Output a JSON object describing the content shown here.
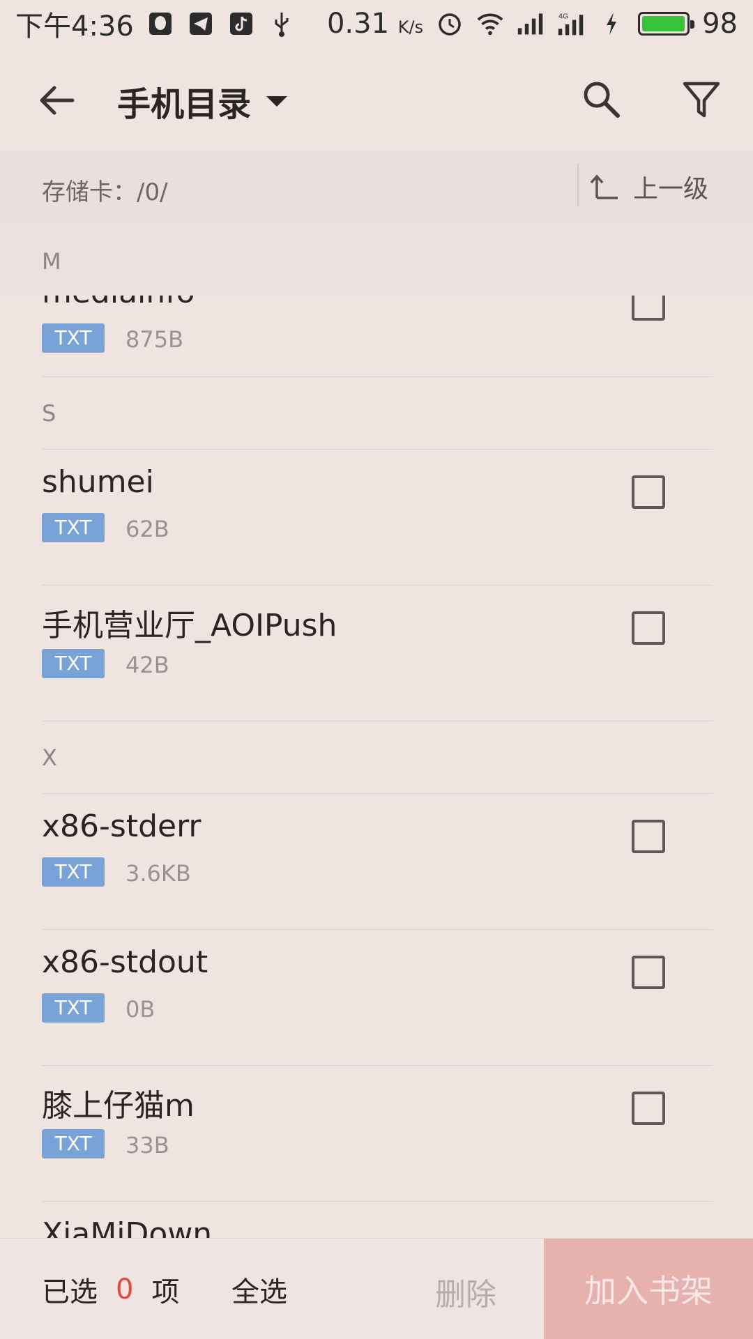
{
  "status_bar": {
    "time": "下午4:36",
    "speed": "0.31",
    "speed_unit": "K/s",
    "battery": "98",
    "battery_level": 0.98,
    "icons": [
      "qq-icon",
      "telegram-icon",
      "tiktok-icon",
      "usb-icon",
      "alarm-icon",
      "wifi-icon",
      "signal-icon",
      "signal-4g-icon",
      "charging-icon",
      "battery-icon"
    ]
  },
  "toolbar": {
    "title": "手机目录",
    "icons": [
      "back-arrow-icon",
      "dropdown-caret-icon",
      "search-icon",
      "filter-icon"
    ]
  },
  "path_bar": {
    "label": "存储卡：/0/",
    "up_label": "上一级"
  },
  "sticky_header": "M",
  "list": [
    {
      "kind": "file",
      "name": "mediainfo",
      "type": "TXT",
      "size": "875B"
    },
    {
      "kind": "section",
      "letter": "S"
    },
    {
      "kind": "file",
      "name": "shumei",
      "type": "TXT",
      "size": "62B"
    },
    {
      "kind": "file",
      "name": "手机营业厅_AOIPush",
      "type": "TXT",
      "size": "42B"
    },
    {
      "kind": "section",
      "letter": "X"
    },
    {
      "kind": "file",
      "name": "x86-stderr",
      "type": "TXT",
      "size": "3.6KB"
    },
    {
      "kind": "file",
      "name": "x86-stdout",
      "type": "TXT",
      "size": "0B"
    },
    {
      "kind": "file",
      "name": "膝上仔猫m",
      "type": "TXT",
      "size": "33B"
    },
    {
      "kind": "file",
      "name": "XiaMiDown",
      "type": "",
      "size": ""
    }
  ],
  "bottom_bar": {
    "selected_prefix": "已选",
    "selected_count": "0",
    "selected_suffix": "项",
    "select_all": "全选",
    "delete": "删除",
    "add_to_shelf": "加入书架"
  },
  "colors": {
    "background": "#f0e4e1",
    "badge": "#79a3d7",
    "accent_count": "#e04a3f",
    "add_button": "#e7b1ae",
    "battery_fill": "#38c23a"
  }
}
